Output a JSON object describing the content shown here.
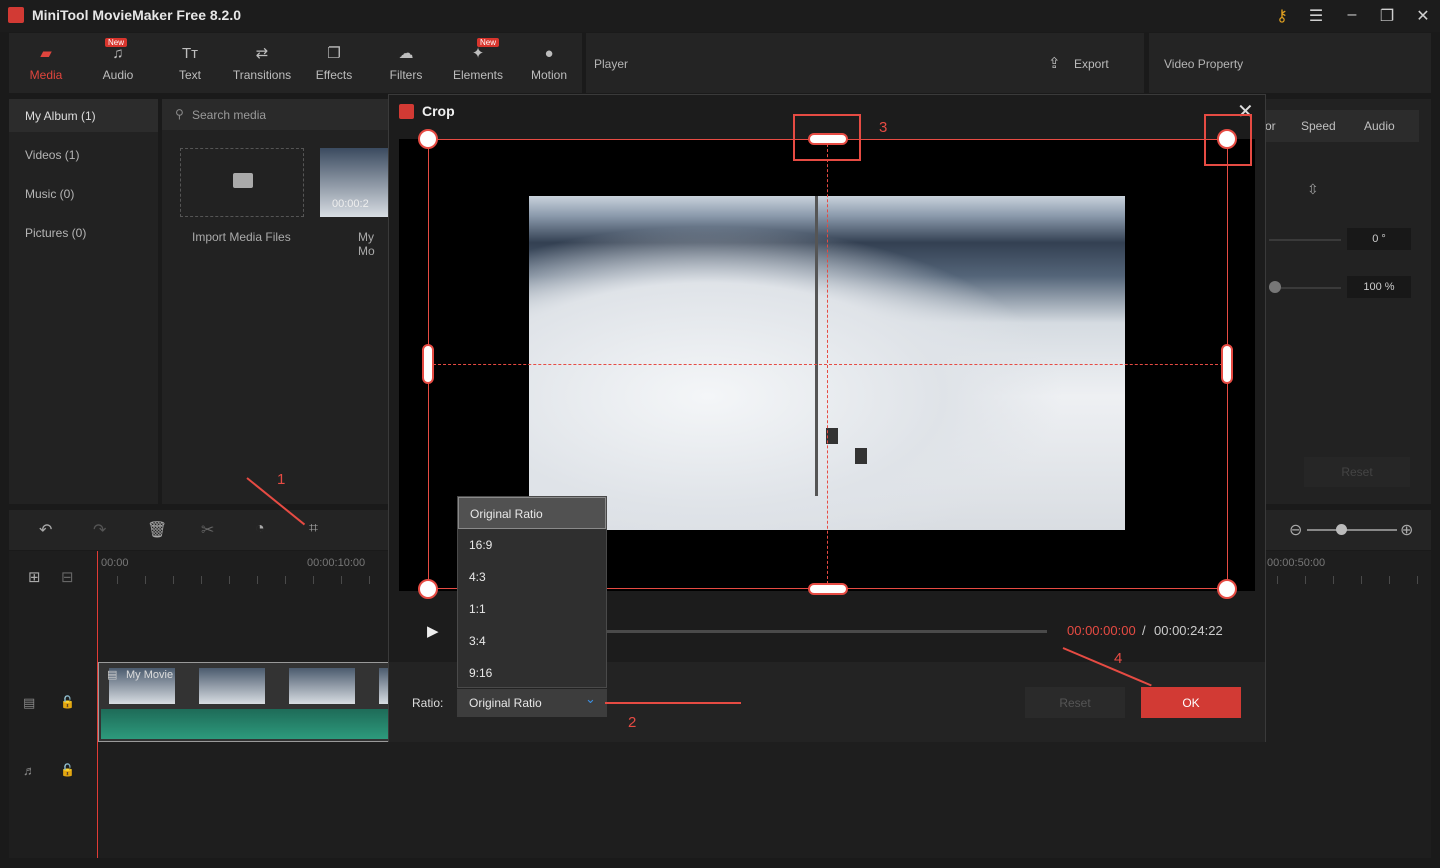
{
  "app": {
    "title": "MiniTool MovieMaker Free 8.2.0"
  },
  "toolbar": {
    "tools": [
      {
        "label": "Media",
        "icon": "media-icon",
        "active": true
      },
      {
        "label": "Audio",
        "icon": "music-note-icon",
        "badge": "New"
      },
      {
        "label": "Text",
        "icon": "text-icon"
      },
      {
        "label": "Transitions",
        "icon": "transitions-icon"
      },
      {
        "label": "Effects",
        "icon": "effects-icon"
      },
      {
        "label": "Filters",
        "icon": "filters-icon"
      },
      {
        "label": "Elements",
        "icon": "elements-icon",
        "badge": "New"
      },
      {
        "label": "Motion",
        "icon": "motion-icon"
      }
    ]
  },
  "player": {
    "title": "Player",
    "export_label": "Export"
  },
  "property": {
    "title": "Video Property",
    "tabs": [
      "or",
      "Speed",
      "Audio"
    ],
    "rotation_value": "0 °",
    "scale_value": "100 %",
    "reset_label": "Reset"
  },
  "album": {
    "items": [
      "My Album (1)",
      "Videos (1)",
      "Music (0)",
      "Pictures (0)"
    ]
  },
  "media": {
    "search_placeholder": "Search media",
    "import_label": "Import Media Files",
    "clip_duration": "00:00:2",
    "clip_label": "My Mo"
  },
  "timeline": {
    "time_labels": [
      "00:00",
      "00:00:10:00",
      "00:00:50:00"
    ],
    "clip_name": "My Movie"
  },
  "crop_dialog": {
    "title": "Crop",
    "time_current": "00:00:00:00",
    "time_separator": "/",
    "time_total": "00:00:24:22",
    "ratio_label": "Ratio:",
    "ratio_selected": "Original Ratio",
    "ratio_options": [
      "Original Ratio",
      "16:9",
      "4:3",
      "1:1",
      "3:4",
      "9:16"
    ],
    "reset_label": "Reset",
    "ok_label": "OK"
  },
  "annotations": [
    "1",
    "2",
    "3",
    "4"
  ],
  "colors": {
    "accent": "#d23a34",
    "annotation": "#e64b43",
    "background": "#1a1a1a"
  }
}
